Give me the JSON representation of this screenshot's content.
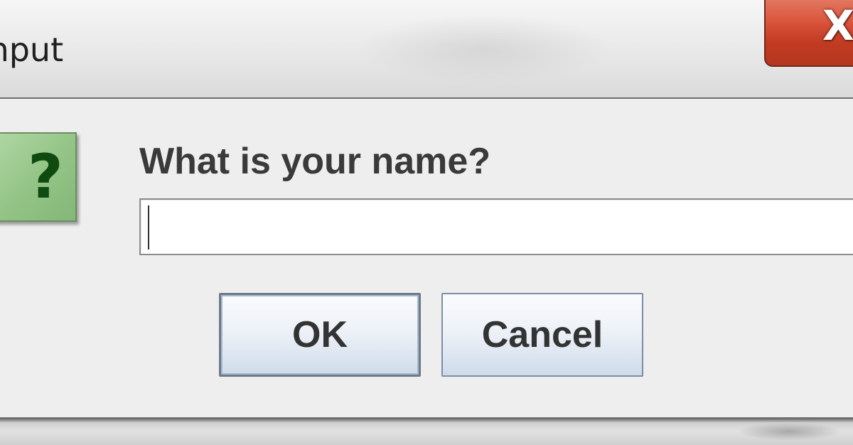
{
  "window": {
    "title": "Input",
    "close_glyph": "X"
  },
  "dialog": {
    "icon": "question-icon",
    "icon_glyph": "?",
    "prompt": "What is your name?",
    "input": {
      "value": "",
      "placeholder": ""
    },
    "buttons": {
      "ok_label": "OK",
      "cancel_label": "Cancel"
    }
  },
  "colors": {
    "close_button": "#d9543a",
    "question_icon_bg": "#93c486",
    "question_glyph": "#0f4a11",
    "button_border": "#7c8ea6"
  }
}
